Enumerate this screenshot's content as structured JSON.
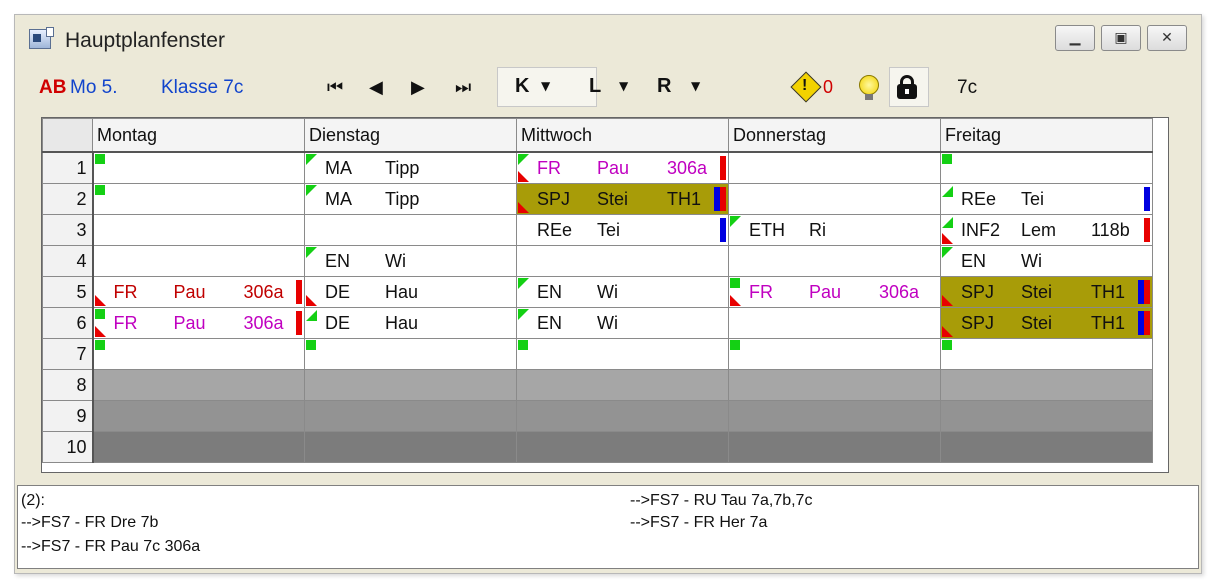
{
  "window": {
    "title": "Hauptplanfenster",
    "controls": [
      "minimize",
      "maximize",
      "close"
    ]
  },
  "toolbar": {
    "ab_label": "AB",
    "date": "Mo 5.",
    "klasse": "Klasse 7c",
    "nav": {
      "first": "⏮",
      "prev": "◀",
      "next": "▶",
      "last": "⏭"
    },
    "k_label": "K",
    "l_label": "L",
    "r_label": "R",
    "dropdown_arrow": "▼",
    "warning_count": "0",
    "class_value": "7c"
  },
  "grid": {
    "days": [
      "Montag",
      "Dienstag",
      "Mittwoch",
      "Donnerstag",
      "Freitag"
    ],
    "periods": [
      "1",
      "2",
      "3",
      "4",
      "5",
      "6",
      "7",
      "8",
      "9",
      "10"
    ],
    "cells": {
      "r1": {
        "mo": {
          "mark": "gs"
        },
        "di": {
          "mark": "gt",
          "a": "MA",
          "b": "Tipp",
          "color": "#111111"
        },
        "mi": {
          "mark": "gt",
          "mark2": "rb",
          "a": "FR",
          "b": "Pau",
          "c": "306a",
          "color": "#c000c0",
          "bar": "red"
        },
        "do": {},
        "fr": {
          "mark": "gs"
        }
      },
      "r2": {
        "mo": {
          "mark": "gs"
        },
        "di": {
          "mark": "gt",
          "a": "MA",
          "b": "Tipp",
          "color": "#111111"
        },
        "mi": {
          "mark": "rb",
          "a": "SPJ",
          "b": "Stei",
          "c": "TH1",
          "color": "#111111",
          "bg": "olive",
          "bar": "blue+red"
        },
        "do": {},
        "fr": {
          "mark": "gb",
          "a": "REe",
          "b": "Tei",
          "color": "#111111",
          "bar": "blue"
        }
      },
      "r3": {
        "mo": {},
        "di": {},
        "mi": {
          "a": "REe",
          "b": "Tei",
          "color": "#111111",
          "bar": "blue"
        },
        "do": {
          "mark": "gt",
          "a": "ETH",
          "b": "Ri",
          "color": "#111111"
        },
        "fr": {
          "mark": "gb",
          "mark2": "rb",
          "a": "INF2",
          "b": "Lem",
          "c": "118b",
          "color": "#111111",
          "bar": "red"
        }
      },
      "r4": {
        "mo": {},
        "di": {
          "mark": "gt",
          "a": "EN",
          "b": "Wi",
          "color": "#111111"
        },
        "mi": {},
        "do": {},
        "fr": {
          "mark": "gt",
          "a": "EN",
          "b": "Wi",
          "color": "#111111"
        }
      },
      "r5": {
        "mo": {
          "mark": "rb",
          "a": "FR",
          "b": "Pau",
          "c": "306a",
          "color": "#c00000",
          "bar": "red"
        },
        "di": {
          "mark": "rb",
          "a": "DE",
          "b": "Hau",
          "color": "#111111"
        },
        "mi": {
          "mark": "gt",
          "a": "EN",
          "b": "Wi",
          "color": "#111111"
        },
        "do": {
          "mark": "gs",
          "mark2": "rb",
          "a": "FR",
          "b": "Pau",
          "c": "306a",
          "color": "#c000c0"
        },
        "fr": {
          "mark": "rb",
          "a": "SPJ",
          "b": "Stei",
          "c": "TH1",
          "color": "#111111",
          "bg": "olive",
          "bar": "blue+red"
        }
      },
      "r6": {
        "mo": {
          "mark": "gs",
          "mark2": "rb",
          "a": "FR",
          "b": "Pau",
          "c": "306a",
          "color": "#c000c0",
          "bar": "red"
        },
        "di": {
          "mark": "gb",
          "a": "DE",
          "b": "Hau",
          "color": "#111111"
        },
        "mi": {
          "mark": "gt",
          "a": "EN",
          "b": "Wi",
          "color": "#111111"
        },
        "do": {},
        "fr": {
          "mark": "rb",
          "a": "SPJ",
          "b": "Stei",
          "c": "TH1",
          "color": "#111111",
          "bg": "olive",
          "bar": "blue+red"
        }
      },
      "r7": {
        "mo": {
          "mark": "gs"
        },
        "di": {
          "mark": "gs"
        },
        "mi": {
          "mark": "gs"
        },
        "do": {
          "mark": "gs"
        },
        "fr": {
          "mark": "gs"
        }
      }
    }
  },
  "info": {
    "heading": "(2):",
    "left": [
      "-->FS7 - FR Dre 7b",
      "-->FS7 - FR Pau 7c 306a"
    ],
    "right": [
      "-->FS7 - RU Tau 7a,7b,7c",
      "-->FS7 - FR Her 7a"
    ]
  },
  "colors": {
    "olive": "#a89c08",
    "green_marker": "#14d014",
    "red_marker": "#e80000",
    "blue_bar": "#0000e0",
    "magenta_text": "#c000c0"
  }
}
